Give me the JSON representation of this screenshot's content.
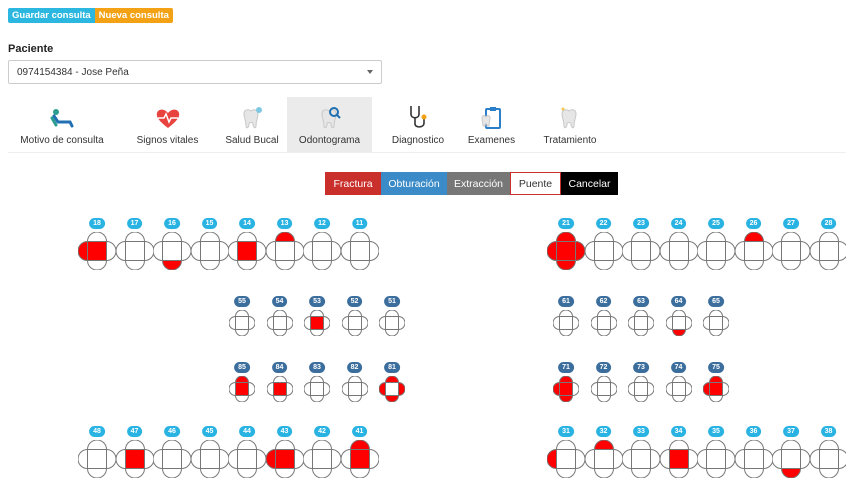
{
  "header": {
    "save_label": "Guardar consulta",
    "new_label": "Nueva consulta"
  },
  "patient": {
    "label": "Paciente",
    "selected": "0974154384 - Jose Peña"
  },
  "tabs": [
    {
      "label": "Motivo de consulta",
      "icon": "dental-chair-icon"
    },
    {
      "label": "Signos vitales",
      "icon": "heart-pulse-icon"
    },
    {
      "label": "Salud Bucal",
      "icon": "tooth-sparkle-icon"
    },
    {
      "label": "Odontograma",
      "icon": "tooth-search-icon",
      "active": true
    },
    {
      "label": "Diagnostico",
      "icon": "stethoscope-icon"
    },
    {
      "label": "Examenes",
      "icon": "clipboard-tooth-icon"
    },
    {
      "label": "Tratamiento",
      "icon": "tooth-icon"
    }
  ],
  "toolbar": {
    "fractura": "Fractura",
    "obturacion": "Obturación",
    "extraccion": "Extracción",
    "puente": "Puente",
    "cancelar": "Cancelar"
  },
  "colors": {
    "fill": "#ff0000",
    "badge_permanent": "#29b3e3",
    "badge_primary": "#3b6e9d"
  },
  "odontogram": {
    "upper_right": [
      {
        "n": "18",
        "f": [
          "l",
          "c"
        ]
      },
      {
        "n": "17",
        "f": []
      },
      {
        "n": "16",
        "f": [
          "b"
        ]
      },
      {
        "n": "15",
        "f": []
      },
      {
        "n": "14",
        "f": [
          "c"
        ]
      },
      {
        "n": "13",
        "f": [
          "t"
        ]
      },
      {
        "n": "12",
        "f": []
      },
      {
        "n": "11",
        "f": []
      }
    ],
    "upper_left": [
      {
        "n": "21",
        "f": [
          "t",
          "l",
          "c",
          "r",
          "b"
        ]
      },
      {
        "n": "22",
        "f": []
      },
      {
        "n": "23",
        "f": []
      },
      {
        "n": "24",
        "f": []
      },
      {
        "n": "25",
        "f": []
      },
      {
        "n": "26",
        "f": [
          "t"
        ]
      },
      {
        "n": "27",
        "f": []
      },
      {
        "n": "28",
        "f": []
      }
    ],
    "primary_upper_right": [
      {
        "n": "55",
        "f": []
      },
      {
        "n": "54",
        "f": []
      },
      {
        "n": "53",
        "f": [
          "c"
        ]
      },
      {
        "n": "52",
        "f": []
      },
      {
        "n": "51",
        "f": []
      }
    ],
    "primary_upper_left": [
      {
        "n": "61",
        "f": []
      },
      {
        "n": "62",
        "f": []
      },
      {
        "n": "63",
        "f": []
      },
      {
        "n": "64",
        "f": [
          "b"
        ]
      },
      {
        "n": "65",
        "f": []
      }
    ],
    "primary_lower_right": [
      {
        "n": "85",
        "f": [
          "t",
          "c"
        ]
      },
      {
        "n": "84",
        "f": [
          "c"
        ]
      },
      {
        "n": "83",
        "f": []
      },
      {
        "n": "82",
        "f": []
      },
      {
        "n": "81",
        "f": [
          "t",
          "l",
          "r",
          "b"
        ]
      }
    ],
    "primary_lower_left": [
      {
        "n": "71",
        "f": [
          "t",
          "l",
          "c",
          "b"
        ]
      },
      {
        "n": "72",
        "f": []
      },
      {
        "n": "73",
        "f": []
      },
      {
        "n": "74",
        "f": []
      },
      {
        "n": "75",
        "f": [
          "t",
          "l",
          "c"
        ]
      }
    ],
    "lower_right": [
      {
        "n": "48",
        "f": []
      },
      {
        "n": "47",
        "f": [
          "c"
        ]
      },
      {
        "n": "46",
        "f": []
      },
      {
        "n": "45",
        "f": []
      },
      {
        "n": "44",
        "f": []
      },
      {
        "n": "43",
        "f": [
          "l",
          "c"
        ]
      },
      {
        "n": "42",
        "f": []
      },
      {
        "n": "41",
        "f": [
          "t",
          "c"
        ]
      }
    ],
    "lower_left": [
      {
        "n": "31",
        "f": [
          "l"
        ]
      },
      {
        "n": "32",
        "f": [
          "t"
        ]
      },
      {
        "n": "33",
        "f": []
      },
      {
        "n": "34",
        "f": [
          "c"
        ]
      },
      {
        "n": "35",
        "f": []
      },
      {
        "n": "36",
        "f": []
      },
      {
        "n": "37",
        "f": [
          "b"
        ]
      },
      {
        "n": "38",
        "f": []
      }
    ]
  }
}
